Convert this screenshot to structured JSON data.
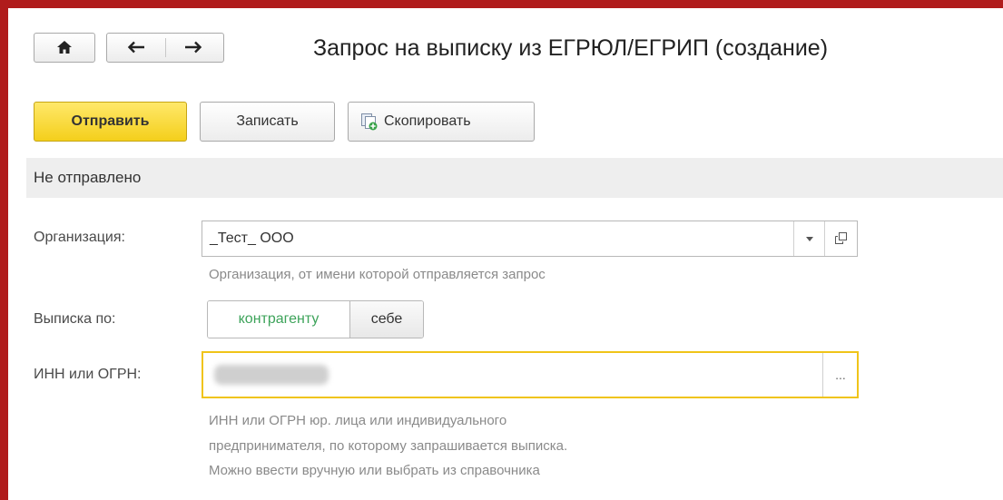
{
  "window": {
    "title": "Запрос на выписку из ЕГРЮЛ/ЕГРИП (создание)"
  },
  "nav": {
    "home_icon": "home-icon",
    "back_icon": "arrow-left-icon",
    "forward_icon": "arrow-right-icon"
  },
  "toolbar": {
    "send_label": "Отправить",
    "save_label": "Записать",
    "copy_label": "Скопировать",
    "copy_icon": "copy-document-icon"
  },
  "status": {
    "text": "Не отправлено"
  },
  "form": {
    "organization": {
      "label": "Организация:",
      "value": "_Тест_ ООО",
      "hint": "Организация, от имени которой отправляется запрос"
    },
    "extract_for": {
      "label": "Выписка по:",
      "options": [
        "контрагенту",
        "себе"
      ],
      "selected": "контрагенту"
    },
    "inn_ogrn": {
      "label": "ИНН или ОГРН:",
      "select_button": "...",
      "hint_lines": [
        "ИНН или ОГРН юр. лица или индивидуального",
        "предпринимателя, по которому запрашивается выписка.",
        "Можно ввести вручную или выбрать из справочника"
      ]
    }
  },
  "colors": {
    "frame": "#b01c1c",
    "primary_button": "#f4cf1b",
    "focus_border": "#f0c419",
    "selected_toggle_text": "#3da35a"
  }
}
